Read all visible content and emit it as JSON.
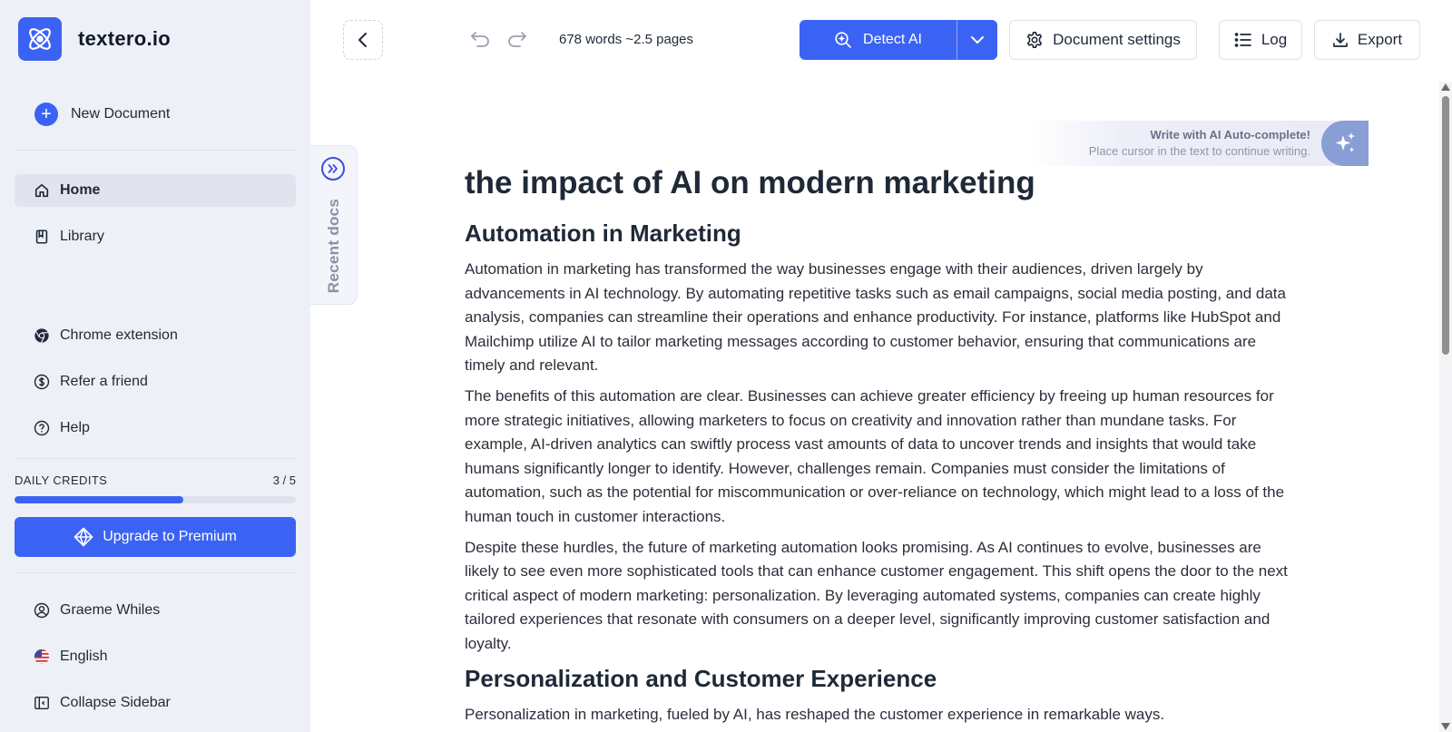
{
  "app": {
    "logo_text": "textero.io"
  },
  "sidebar": {
    "new_document": "New Document",
    "nav": [
      {
        "label": "Home",
        "icon": "home-icon",
        "active": true
      },
      {
        "label": "Library",
        "icon": "book-icon"
      }
    ],
    "extra": [
      {
        "label": "Chrome extension",
        "icon": "chrome-icon"
      },
      {
        "label": "Refer a friend",
        "icon": "dollar-circle-icon"
      },
      {
        "label": "Help",
        "icon": "help-circle-icon"
      }
    ],
    "credits": {
      "label": "DAILY CREDITS",
      "count": "3 / 5",
      "used_fraction": 0.6
    },
    "upgrade_label": "Upgrade to Premium",
    "user": {
      "name": "Graeme Whiles",
      "icon": "user-circle-icon"
    },
    "language": {
      "label": "English",
      "icon": "us-flag-icon"
    },
    "collapse": {
      "label": "Collapse Sidebar",
      "icon": "collapse-sidebar-icon"
    }
  },
  "recent_docs": {
    "label": "Recent docs"
  },
  "toolbar": {
    "word_count": "678 words ~2.5 pages",
    "detect_ai": "Detect AI",
    "document_settings": "Document settings",
    "log": "Log",
    "export": "Export"
  },
  "autocomplete": {
    "title": "Write with AI Auto-complete!",
    "subtitle": "Place cursor in the text to continue writing."
  },
  "document": {
    "title": "the impact of AI on modern marketing",
    "sections": [
      {
        "heading": "Automation in Marketing",
        "paragraphs": [
          "Automation in marketing has transformed the way businesses engage with their audiences, driven largely by advancements in AI technology. By automating repetitive tasks such as email campaigns, social media posting, and data analysis, companies can streamline their operations and enhance productivity. For instance, platforms like HubSpot and Mailchimp utilize AI to tailor marketing messages according to customer behavior, ensuring that communications are timely and relevant.",
          "The benefits of this automation are clear. Businesses can achieve greater efficiency by freeing up human resources for more strategic initiatives, allowing marketers to focus on creativity and innovation rather than mundane tasks. For example, AI-driven analytics can swiftly process vast amounts of data to uncover trends and insights that would take humans significantly longer to identify. However, challenges remain. Companies must consider the limitations of automation, such as the potential for miscommunication or over-reliance on technology, which might lead to a loss of the human touch in customer interactions.",
          "Despite these hurdles, the future of marketing automation looks promising. As AI continues to evolve, businesses are likely to see even more sophisticated tools that can enhance customer engagement. This shift opens the door to the next critical aspect of modern marketing: personalization. By leveraging automated systems, companies can create highly tailored experiences that resonate with consumers on a deeper level, significantly improving customer satisfaction and loyalty."
        ]
      },
      {
        "heading": "Personalization and Customer Experience",
        "paragraphs": [
          "Personalization in marketing, fueled by AI, has reshaped the customer experience in remarkable ways."
        ]
      }
    ]
  },
  "colors": {
    "accent": "#3b63f3",
    "sidebar_bg": "#eef0f8"
  }
}
